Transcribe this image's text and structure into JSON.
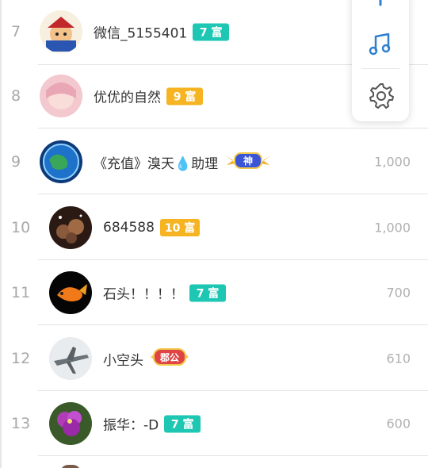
{
  "rows": [
    {
      "rank": "7",
      "name": "微信_5155401",
      "badge": "7 富",
      "badge_color": "#1ec7b3",
      "value": ""
    },
    {
      "rank": "8",
      "name": "优优的自然",
      "badge": "9 富",
      "badge_color": "#f6b322",
      "value": ""
    },
    {
      "rank": "9",
      "name": "《充值》溴天💧助理",
      "badge": "神",
      "badge_style": "god",
      "value": "1,000"
    },
    {
      "rank": "10",
      "name": "684588",
      "badge": "10 富",
      "badge_color": "#f6b322",
      "value": "1,000"
    },
    {
      "rank": "11",
      "name": "石头！！！！",
      "badge": "7 富",
      "badge_color": "#1ec7b3",
      "value": "700"
    },
    {
      "rank": "12",
      "name": "小空头",
      "badge": "郡公",
      "badge_style": "duke",
      "value": "610"
    },
    {
      "rank": "13",
      "name": "振华：-D",
      "badge": "7 富",
      "badge_color": "#1ec7b3",
      "value": "600"
    }
  ],
  "float_panel": {
    "icons": [
      "plus-icon",
      "music-note-icon",
      "gear-icon"
    ],
    "accent": "#2f80d1"
  }
}
